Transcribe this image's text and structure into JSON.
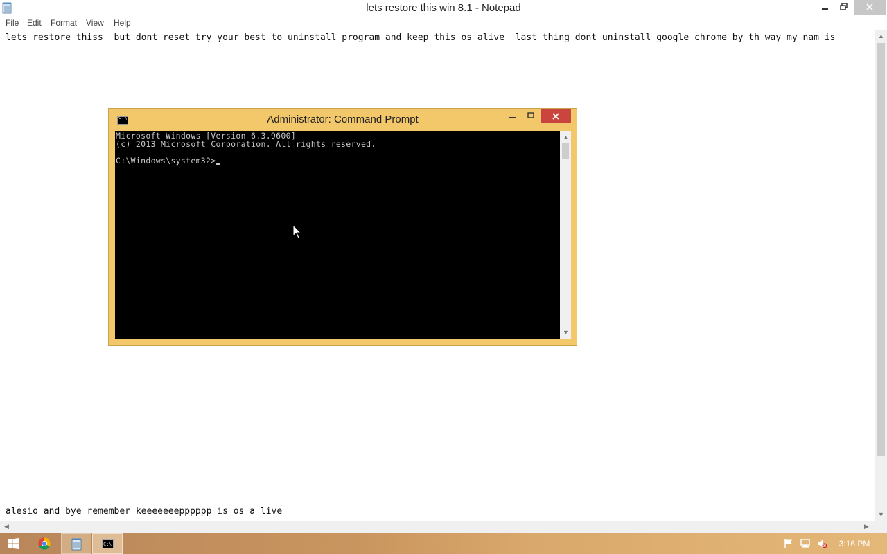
{
  "notepad": {
    "title": "lets restore this win 8.1 - Notepad",
    "menu": [
      "File",
      "Edit",
      "Format",
      "View",
      "Help"
    ],
    "lines": [
      "lets restore thiss  but dont reset try your best to uninstall program and keep this os alive  last thing dont uninstall google chrome by th way my nam is",
      "alesio and bye remember keeeeeeepppppp is os a live"
    ]
  },
  "cmd": {
    "title": "Administrator: Command Prompt",
    "lines": [
      "Microsoft Windows [Version 6.3.9600]",
      "(c) 2013 Microsoft Corporation. All rights reserved."
    ],
    "prompt": "C:\\Windows\\system32>"
  },
  "taskbar": {
    "clock": "3:16 PM"
  },
  "icons": {
    "window_controls": [
      "minimize-icon",
      "maximize-icon",
      "restore-icon",
      "close-icon"
    ],
    "taskbar": [
      "windows-start-icon",
      "chrome-icon",
      "notepad-icon",
      "command-prompt-icon"
    ],
    "tray": [
      "action-center-flag-icon",
      "network-icon",
      "volume-muted-icon"
    ]
  },
  "colors": {
    "cmd_frame": "#f3c86a",
    "cmd_close": "#c9453e",
    "console_bg": "#000000",
    "console_text": "#c8c8c8",
    "taskbar": "#c9955f"
  }
}
